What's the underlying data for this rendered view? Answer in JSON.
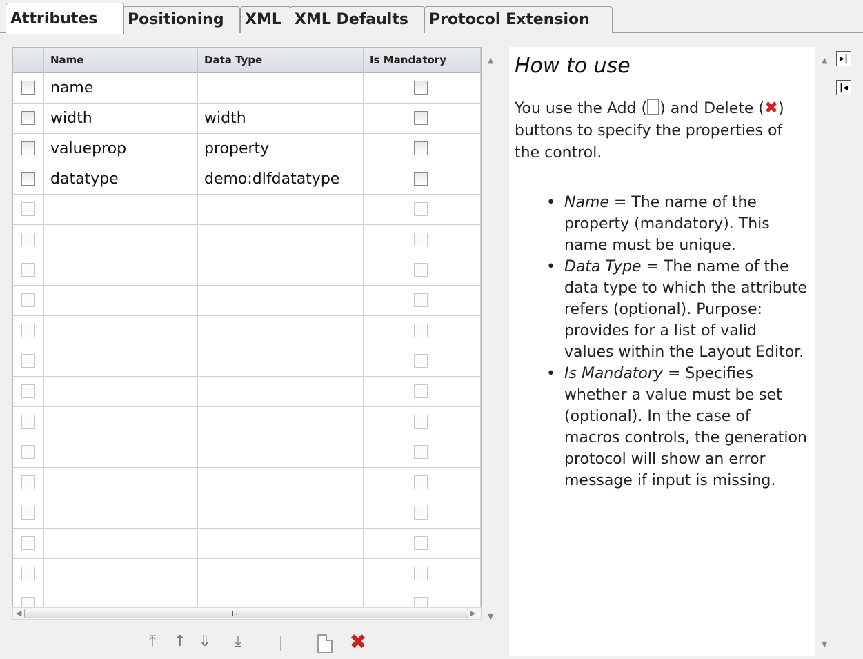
{
  "tabs": [
    {
      "label": "Attributes",
      "active": true
    },
    {
      "label": "Positioning",
      "active": false
    },
    {
      "label": "XML",
      "active": false
    },
    {
      "label": "XML Defaults",
      "active": false
    },
    {
      "label": "Protocol Extension",
      "active": false
    }
  ],
  "grid": {
    "columns": [
      "Name",
      "Data Type",
      "Is Mandatory"
    ],
    "rows": [
      {
        "name": "name",
        "data_type": "",
        "mandatory": false
      },
      {
        "name": "width",
        "data_type": "width",
        "mandatory": false
      },
      {
        "name": "valueprop",
        "data_type": "property",
        "mandatory": false
      },
      {
        "name": "datatype",
        "data_type": "demo:dlfdatatype",
        "mandatory": false
      }
    ],
    "empty_rows": 14,
    "hscroll_grip": "III"
  },
  "toolbar": {
    "icons": [
      "move-top-icon",
      "move-up-icon",
      "move-down-icon",
      "move-bottom-icon",
      "add-icon",
      "delete-icon"
    ]
  },
  "help": {
    "title": "How to use",
    "intro_before_add": "You use the Add (",
    "intro_between": ") and Delete (",
    "intro_after": ") buttons to specify the properties of the control.",
    "items": [
      {
        "term": "Name",
        "text": " = The name of the property (mandatory). This name must be unique."
      },
      {
        "term": "Data Type",
        "text": " = The name of the data type to which the attribute refers (optional). Purpose: provides for a list of valid values within the Layout Editor."
      },
      {
        "term": "Is Mandatory",
        "text": " = Specifies whether a value must be set (optional). In the case of macros controls, the generation protocol will show an error message if input is missing."
      }
    ]
  },
  "side_buttons": {
    "expand": "expand-panel-icon",
    "collapse": "collapse-panel-icon"
  },
  "colors": {
    "delete": "#cc2222",
    "grid_header": "#d7dde6",
    "background": "#f0f0f0"
  }
}
